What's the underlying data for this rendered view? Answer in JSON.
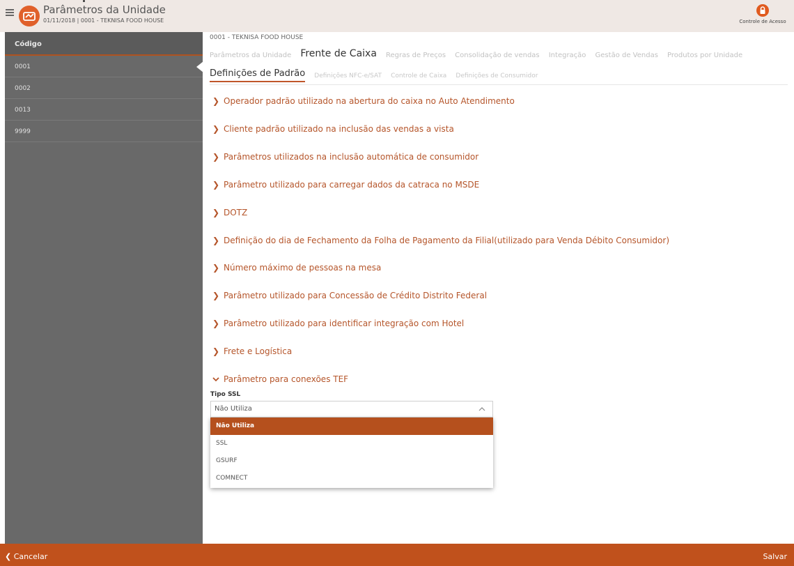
{
  "header": {
    "title": "Parâmetros da Unidade",
    "subtitle": "01/11/2018 | 0001 - TEKNISA FOOD HOUSE",
    "access_label": "Controle de Acesso"
  },
  "sidebar": {
    "column_header": "Código",
    "rows": [
      "0001",
      "0002",
      "0013",
      "9999"
    ],
    "active_index": 0
  },
  "main": {
    "unit_label": "0001 - TEKNISA FOOD HOUSE",
    "tabs": [
      {
        "label": "Parâmetros da Unidade"
      },
      {
        "label": "Frente de Caixa"
      },
      {
        "label": "Regras de Preços"
      },
      {
        "label": "Consolidação de vendas"
      },
      {
        "label": "Integração"
      },
      {
        "label": "Gestão de Vendas"
      },
      {
        "label": "Produtos por Unidade"
      }
    ],
    "active_tab": "Frente de Caixa",
    "subtabs": [
      {
        "label": "Definições de Padrão"
      },
      {
        "label": "Definições NFC-e/SAT"
      },
      {
        "label": "Controle de Caixa"
      },
      {
        "label": "Definições de Consumidor"
      }
    ],
    "active_subtab": "Definições de Padrão",
    "sections": [
      "Operador padrão utilizado na abertura do caixa no Auto Atendimento",
      "Cliente padrão utilizado na inclusão das vendas a vista",
      "Parâmetros utilizados na inclusão automática de consumidor",
      "Parâmetro utilizado para carregar dados da catraca no MSDE",
      "DOTZ",
      "Definição do dia de Fechamento da Folha de Pagamento da Filial(utilizado para Venda Débito Consumidor)",
      "Número máximo de pessoas na mesa",
      "Parâmetro utilizado para Concessão de Crédito Distrito Federal",
      "Parâmetro utilizado para identificar integração com Hotel",
      "Frete e Logística",
      "Parâmetro para conexões TEF"
    ],
    "expanded_section": "Parâmetro para conexões TEF",
    "ssl": {
      "label": "Tipo SSL",
      "value": "Não Utiliza",
      "options": [
        "Não Utiliza",
        "SSL",
        "GSURF",
        "COMNECT"
      ],
      "selected_option": "Não Utiliza"
    }
  },
  "footer": {
    "cancel_label": "Cancelar",
    "save_label": "Salvar"
  },
  "colors": {
    "accent": "#c0511c",
    "section_text": "#b5552a",
    "sidebar_bg": "#696969",
    "header_bg": "#efe8e4"
  },
  "icons": {
    "menu": "hamburger-icon",
    "logo": "app-logo-icon",
    "lock": "lock-icon",
    "collapsed": "chevron-right-icon",
    "expanded": "chevron-down-icon",
    "select": "chevron-up-icon",
    "back": "chevron-left-icon"
  }
}
